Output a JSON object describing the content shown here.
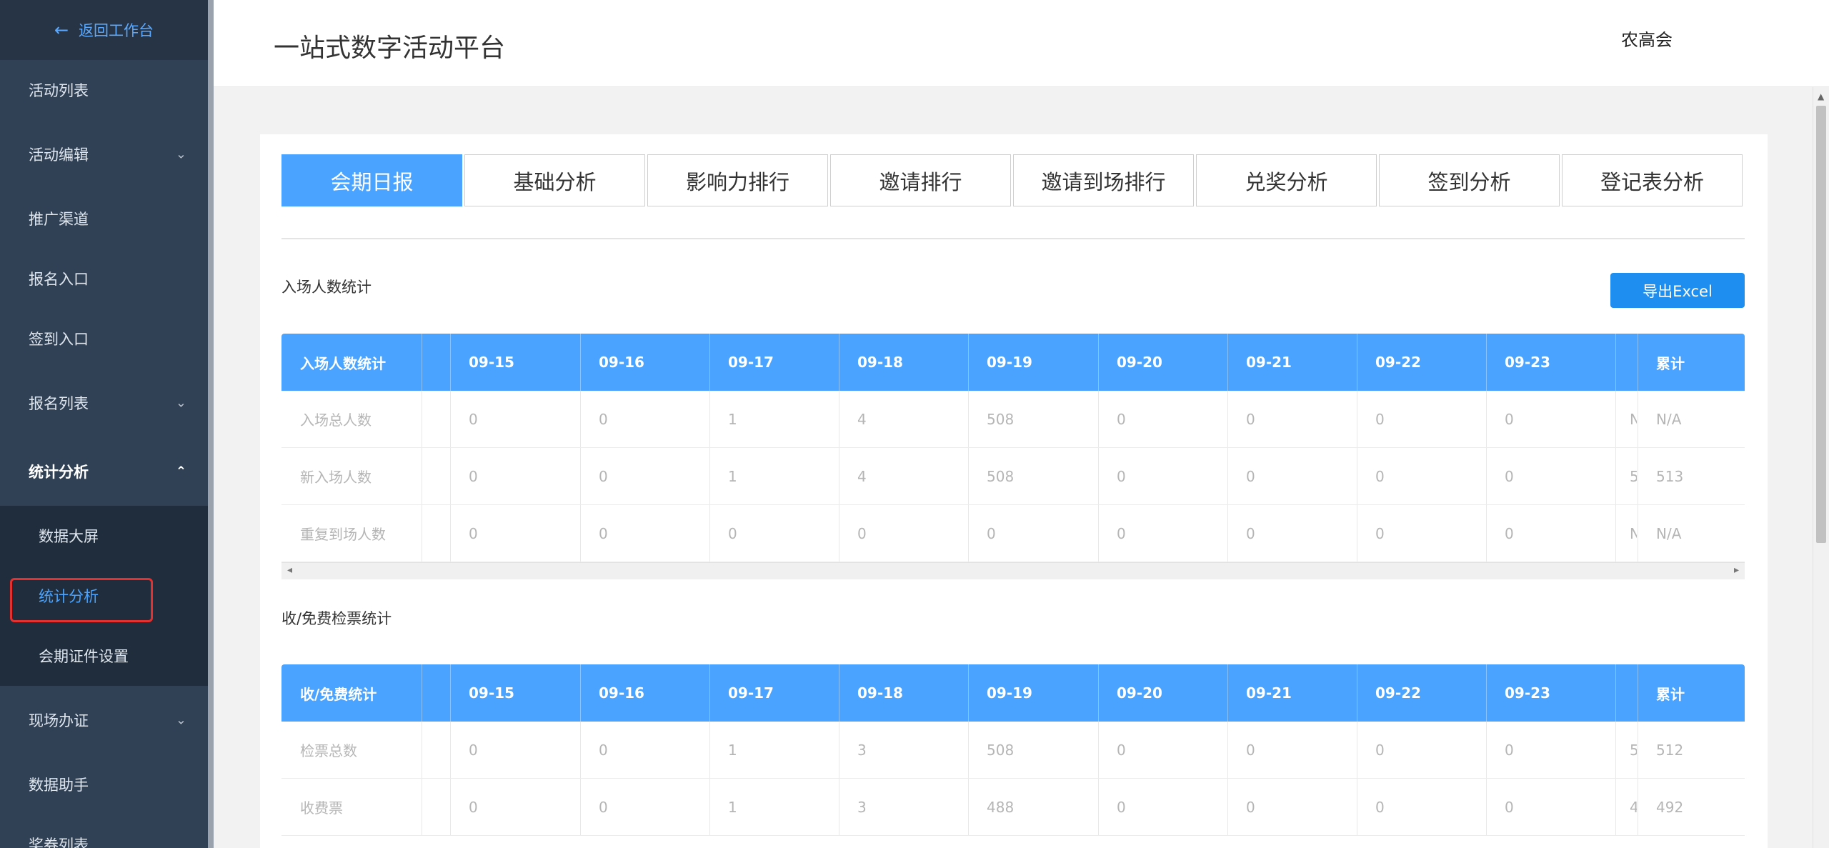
{
  "sidebar": {
    "back_label": "返回工作台",
    "items": [
      {
        "label": "活动列表"
      },
      {
        "label": "活动编辑",
        "chevron": "down"
      },
      {
        "label": "推广渠道"
      },
      {
        "label": "报名入口"
      },
      {
        "label": "签到入口"
      },
      {
        "label": "报名列表",
        "chevron": "down"
      },
      {
        "label": "统计分析",
        "chevron": "up"
      }
    ],
    "submenu": [
      {
        "label": "数据大屏"
      },
      {
        "label": "统计分析"
      },
      {
        "label": "会期证件设置"
      }
    ],
    "items_after": [
      {
        "label": "现场办证",
        "chevron": "down"
      },
      {
        "label": "数据助手"
      },
      {
        "label": "奖券列表"
      }
    ]
  },
  "header": {
    "title": "一站式数字活动平台",
    "user": "农高会"
  },
  "tabs": [
    "会期日报",
    "基础分析",
    "影响力排行",
    "邀请排行",
    "邀请到场排行",
    "兑奖分析",
    "签到分析",
    "登记表分析"
  ],
  "export_label": "导出Excel",
  "dates": [
    "09-15",
    "09-16",
    "09-17",
    "09-18",
    "09-19",
    "09-20",
    "09-21",
    "09-22",
    "09-23"
  ],
  "total_label": "累计",
  "entry": {
    "section_title": "入场人数统计",
    "header": "入场人数统计",
    "rows": [
      {
        "label": "入场总人数",
        "values": [
          "0",
          "0",
          "1",
          "4",
          "508",
          "0",
          "0",
          "0",
          "0"
        ],
        "partial": "N",
        "total": "N/A"
      },
      {
        "label": "新入场人数",
        "values": [
          "0",
          "0",
          "1",
          "4",
          "508",
          "0",
          "0",
          "0",
          "0"
        ],
        "partial": "5",
        "total": "513"
      },
      {
        "label": "重复到场人数",
        "values": [
          "0",
          "0",
          "0",
          "0",
          "0",
          "0",
          "0",
          "0",
          "0"
        ],
        "partial": "N",
        "total": "N/A"
      }
    ]
  },
  "ticket": {
    "section_title": "收/免费检票统计",
    "header": "收/免费统计",
    "rows": [
      {
        "label": "检票总数",
        "values": [
          "0",
          "0",
          "1",
          "3",
          "508",
          "0",
          "0",
          "0",
          "0"
        ],
        "partial": "5",
        "total": "512"
      },
      {
        "label": "收费票",
        "values": [
          "0",
          "0",
          "1",
          "3",
          "488",
          "0",
          "0",
          "0",
          "0"
        ],
        "partial": "4",
        "total": "492"
      }
    ]
  }
}
